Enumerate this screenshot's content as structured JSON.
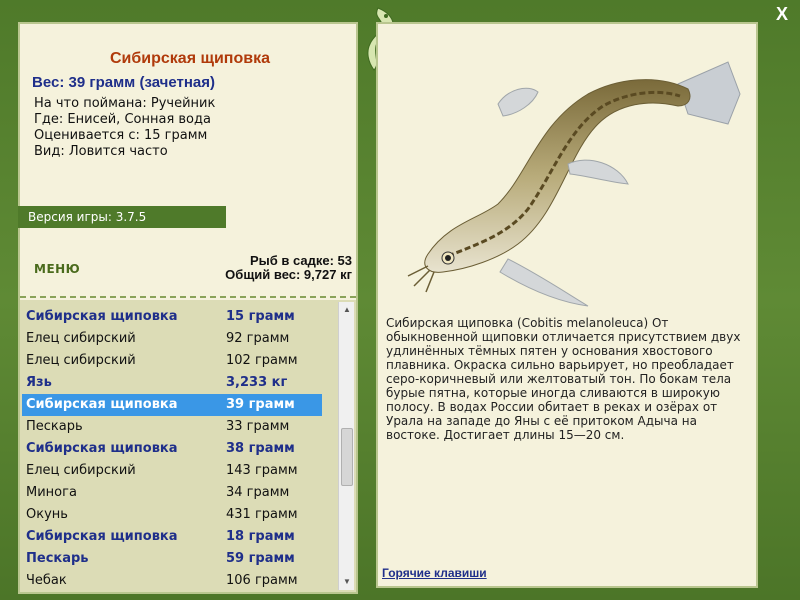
{
  "fish": {
    "title": "Сибирская щиповка",
    "weight": "Вес: 39 грамм (зачетная)",
    "caught_on": "На что поймана: Ручейник",
    "location": "Где: Енисей, Сонная вода",
    "valued_from": "Оценивается с: 15 грамм",
    "kind": "Вид: Ловится часто",
    "description": "Сибирская щиповка (Cobitis melanoleuca) От обыкновенной щиповки отличается присутствием двух удлинённых тёмных пятен у основания хвостового плавника. Окраска сильно варьирует, но преобладает серо-коричневый или желтоватый тон. По бокам тела бурые пятна, которые иногда сливаются в широкую полосу. В водах России обитает в реках и озёрах от Урала на западе до Яны с её притоком Адыча на востоке. Достигает длины 15—20 см."
  },
  "version": "Версия игры: 3.7.5",
  "menu_label": "МЕНЮ",
  "stats": {
    "fish_in_keepnet": "Рыб в садке: 53",
    "total_weight": "Общий вес: 9,727 кг"
  },
  "catch_list": [
    {
      "name": "Сибирская щиповка",
      "weight": "15 грамм",
      "bold": true
    },
    {
      "name": "Елец сибирский",
      "weight": "92 грамм",
      "bold": false
    },
    {
      "name": "Елец сибирский",
      "weight": "102 грамм",
      "bold": false
    },
    {
      "name": "Язь",
      "weight": "3,233 кг",
      "bold": true
    },
    {
      "name": "Сибирская щиповка",
      "weight": "39 грамм",
      "bold": true,
      "selected": true
    },
    {
      "name": "Пескарь",
      "weight": "33 грамм",
      "bold": false
    },
    {
      "name": "Сибирская щиповка",
      "weight": "38 грамм",
      "bold": true
    },
    {
      "name": "Елец сибирский",
      "weight": "143 грамм",
      "bold": false
    },
    {
      "name": "Минога",
      "weight": "34 грамм",
      "bold": false
    },
    {
      "name": "Окунь",
      "weight": "431 грамм",
      "bold": false
    },
    {
      "name": "Сибирская щиповка",
      "weight": "18 грамм",
      "bold": true
    },
    {
      "name": "Пескарь",
      "weight": "59 грамм",
      "bold": true
    },
    {
      "name": "Чебак",
      "weight": "106 грамм",
      "bold": false
    }
  ],
  "hotkeys_label": "Горячие клавиши",
  "close_label": "X",
  "colors": {
    "frame": "#5f8a35",
    "panel": "#f5f2dc",
    "title": "#b03a0a",
    "accent": "#1f2f8a",
    "selection": "#3a97e6"
  },
  "icons": [
    "emblem-icon",
    "fish-image",
    "scroll-up-icon",
    "scroll-down-icon",
    "close-icon"
  ]
}
